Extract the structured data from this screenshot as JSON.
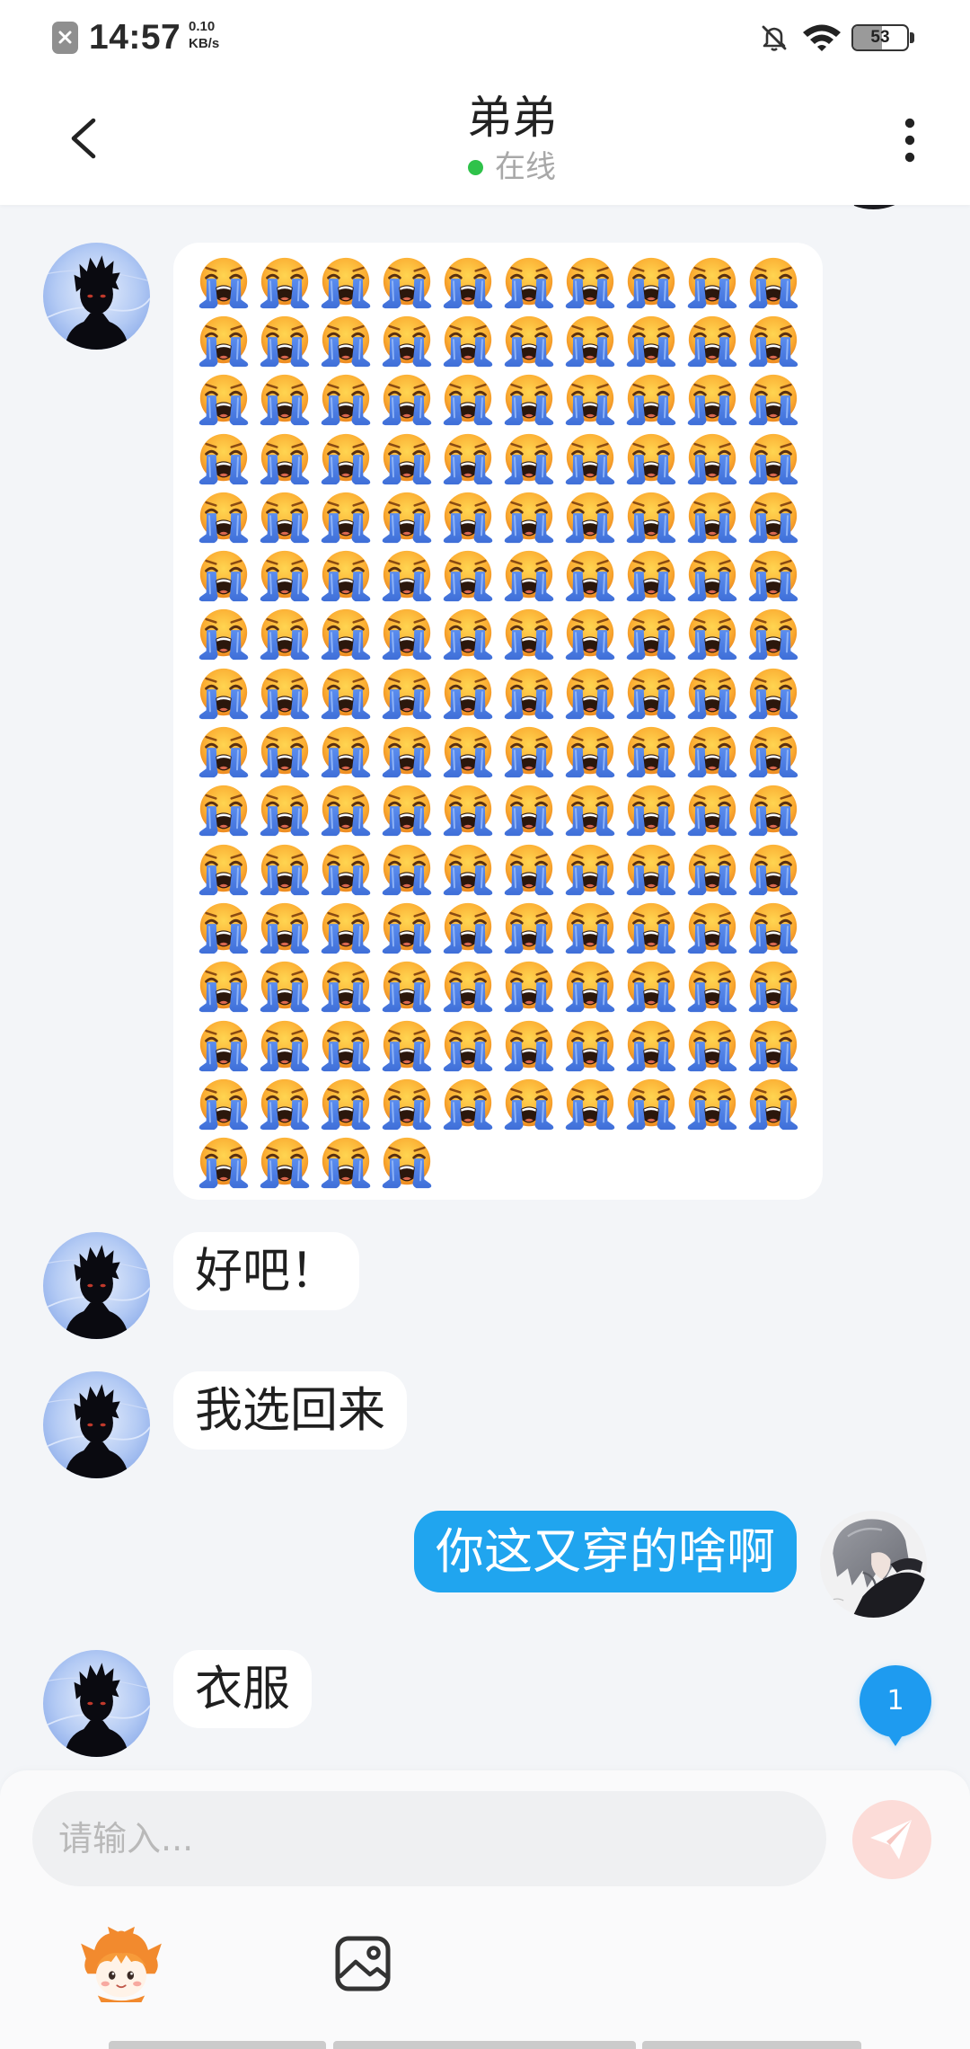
{
  "status_bar": {
    "time": "14:57",
    "net_speed_value": "0.10",
    "net_speed_unit": "KB/s",
    "battery_level": "53",
    "battery_fraction": 0.53,
    "icons": [
      "notification-blocked-icon",
      "mute-bell-icon",
      "wifi-icon",
      "battery-icon"
    ]
  },
  "header": {
    "back_icon": "back-chevron-icon",
    "title": "弟弟",
    "status": "在线",
    "menu_icon": "more-vertical-icon"
  },
  "chat": {
    "messages": [
      {
        "side": "left",
        "sender": "contact",
        "type": "emoji",
        "icon": "loudly-crying-face-emoji",
        "count": 154
      },
      {
        "side": "left",
        "sender": "contact",
        "type": "text",
        "text": "好吧！"
      },
      {
        "side": "left",
        "sender": "contact",
        "type": "text",
        "text": "我选回来"
      },
      {
        "side": "right",
        "sender": "me",
        "type": "text",
        "text": "你这又穿的啥啊"
      },
      {
        "side": "left",
        "sender": "contact",
        "type": "text",
        "text": "衣服"
      }
    ]
  },
  "unread_badge": "1",
  "composer": {
    "placeholder": "请输入...",
    "send_icon": "paper-plane-icon",
    "tools": [
      "mascot-sticker-icon",
      "image-icon"
    ]
  },
  "colors": {
    "sent_bubble": "#20a5ef",
    "online_dot": "#2fc24a",
    "unread_badge": "#1e9bf0",
    "send_button_disabled": "#fcdcd8"
  }
}
